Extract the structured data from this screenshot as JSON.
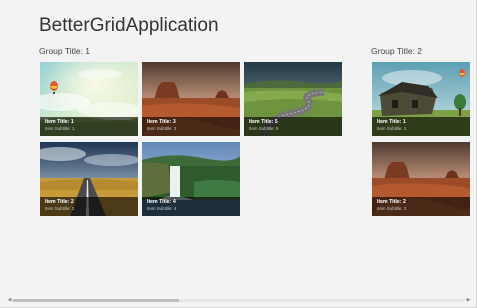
{
  "app": {
    "title": "BetterGridApplication"
  },
  "groups": [
    {
      "title": "Group Title: 1",
      "items": [
        {
          "title": "Item Title: 1",
          "subtitle": "Item Subtitle: 1"
        },
        {
          "title": "Item Title: 3",
          "subtitle": "Item Subtitle: 3"
        },
        {
          "title": "Item Title: 5",
          "subtitle": "Item Subtitle: 5"
        },
        {
          "title": "Item Title: 2",
          "subtitle": "Item Subtitle: 2"
        },
        {
          "title": "Item Title: 4",
          "subtitle": "Item Subtitle: 4"
        }
      ]
    },
    {
      "title": "Group Title: 2",
      "items": [
        {
          "title": "Item Title: 1",
          "subtitle": "Item Subtitle: 1"
        },
        {
          "title": "Item Title: 2",
          "subtitle": "Item Subtitle: 2"
        }
      ]
    }
  ],
  "scrollbar": {
    "left_arrow_icon": "chevron-left-icon",
    "right_arrow_icon": "chevron-right-icon"
  }
}
